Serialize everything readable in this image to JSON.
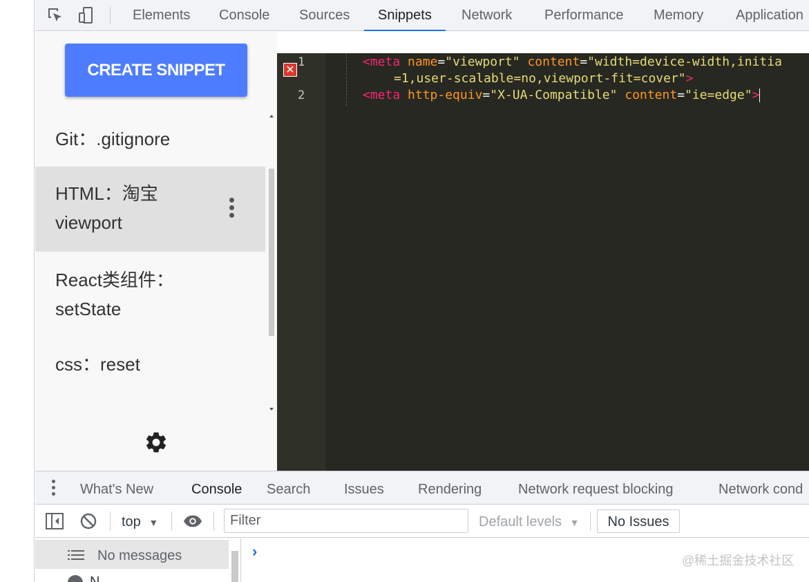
{
  "devtools": {
    "main_tabs": [
      "Elements",
      "Console",
      "Sources",
      "Snippets",
      "Network",
      "Performance",
      "Memory",
      "Application"
    ],
    "active_tab": "Snippets",
    "icons": {
      "inspect": "inspect-element-icon",
      "device": "device-toolbar-icon"
    }
  },
  "sidebar": {
    "create_button": "CREATE SNIPPET",
    "items": [
      {
        "label": "Git：.gitignore"
      },
      {
        "label": "HTML：淘宝 viewport",
        "line1": "HTML：淘宝",
        "line2": "viewport",
        "selected": true
      },
      {
        "label": "React类组件：setState",
        "line1": "React类组件：",
        "line2": "setState"
      },
      {
        "label": "css：reset"
      }
    ],
    "settings_icon": "gear-icon"
  },
  "editor": {
    "line_numbers": [
      "1",
      "2"
    ],
    "error_marker": "✕",
    "line1": {
      "tag_open": "<meta",
      "attr1": "name",
      "eq": "=",
      "val1": "\"viewport\"",
      "attr2": "content",
      "val2a": "\"width=device-width,initia",
      "val2b": "=1,user-scalable=no,viewport-fit=cover\"",
      "tag_close": ">"
    },
    "line2": {
      "tag_open": "<meta",
      "attr1": "http-equiv",
      "eq": "=",
      "val1": "\"X-UA-Compatible\"",
      "attr2": "content",
      "val2": "\"ie=edge\"",
      "tag_close": ">"
    },
    "colors": {
      "background": "#272822",
      "tag": "#f92672",
      "attr": "#fd971f",
      "string": "#e6db74"
    }
  },
  "drawer": {
    "tabs": [
      "What's New",
      "Console",
      "Search",
      "Issues",
      "Rendering",
      "Network request blocking",
      "Network cond"
    ],
    "active_tab": "Console",
    "toolbar": {
      "context": "top",
      "filter_placeholder": "Filter",
      "levels": "Default levels",
      "issues": "No Issues"
    },
    "sidebar": {
      "messages": "No messages",
      "second_row": "N"
    },
    "prompt": "›"
  },
  "watermark": "@稀土掘金技术社区",
  "accent_color": "#1a73e8",
  "create_button_color": "#4d7cfe"
}
